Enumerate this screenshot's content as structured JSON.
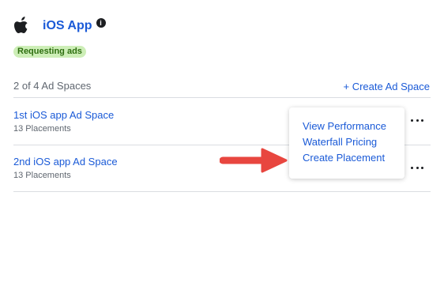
{
  "app": {
    "title": "iOS App",
    "info_glyph": "i",
    "icon": "apple-logo",
    "status": "Requesting ads"
  },
  "ad_spaces": {
    "count_label": "2 of 4 Ad Spaces",
    "create_label": "+ Create Ad Space",
    "rows": [
      {
        "title": "1st iOS app Ad Space",
        "subtitle": "13 Placements"
      },
      {
        "title": "2nd iOS app Ad Space",
        "subtitle": "13 Placements"
      }
    ]
  },
  "menu": {
    "items": [
      "View Performance",
      "Waterfall Pricing",
      "Create Placement"
    ]
  },
  "colors": {
    "link": "#1a5ad7",
    "badge_bg": "#cdeeb7",
    "badge_text": "#2e6f10",
    "arrow": "#e8463f"
  }
}
